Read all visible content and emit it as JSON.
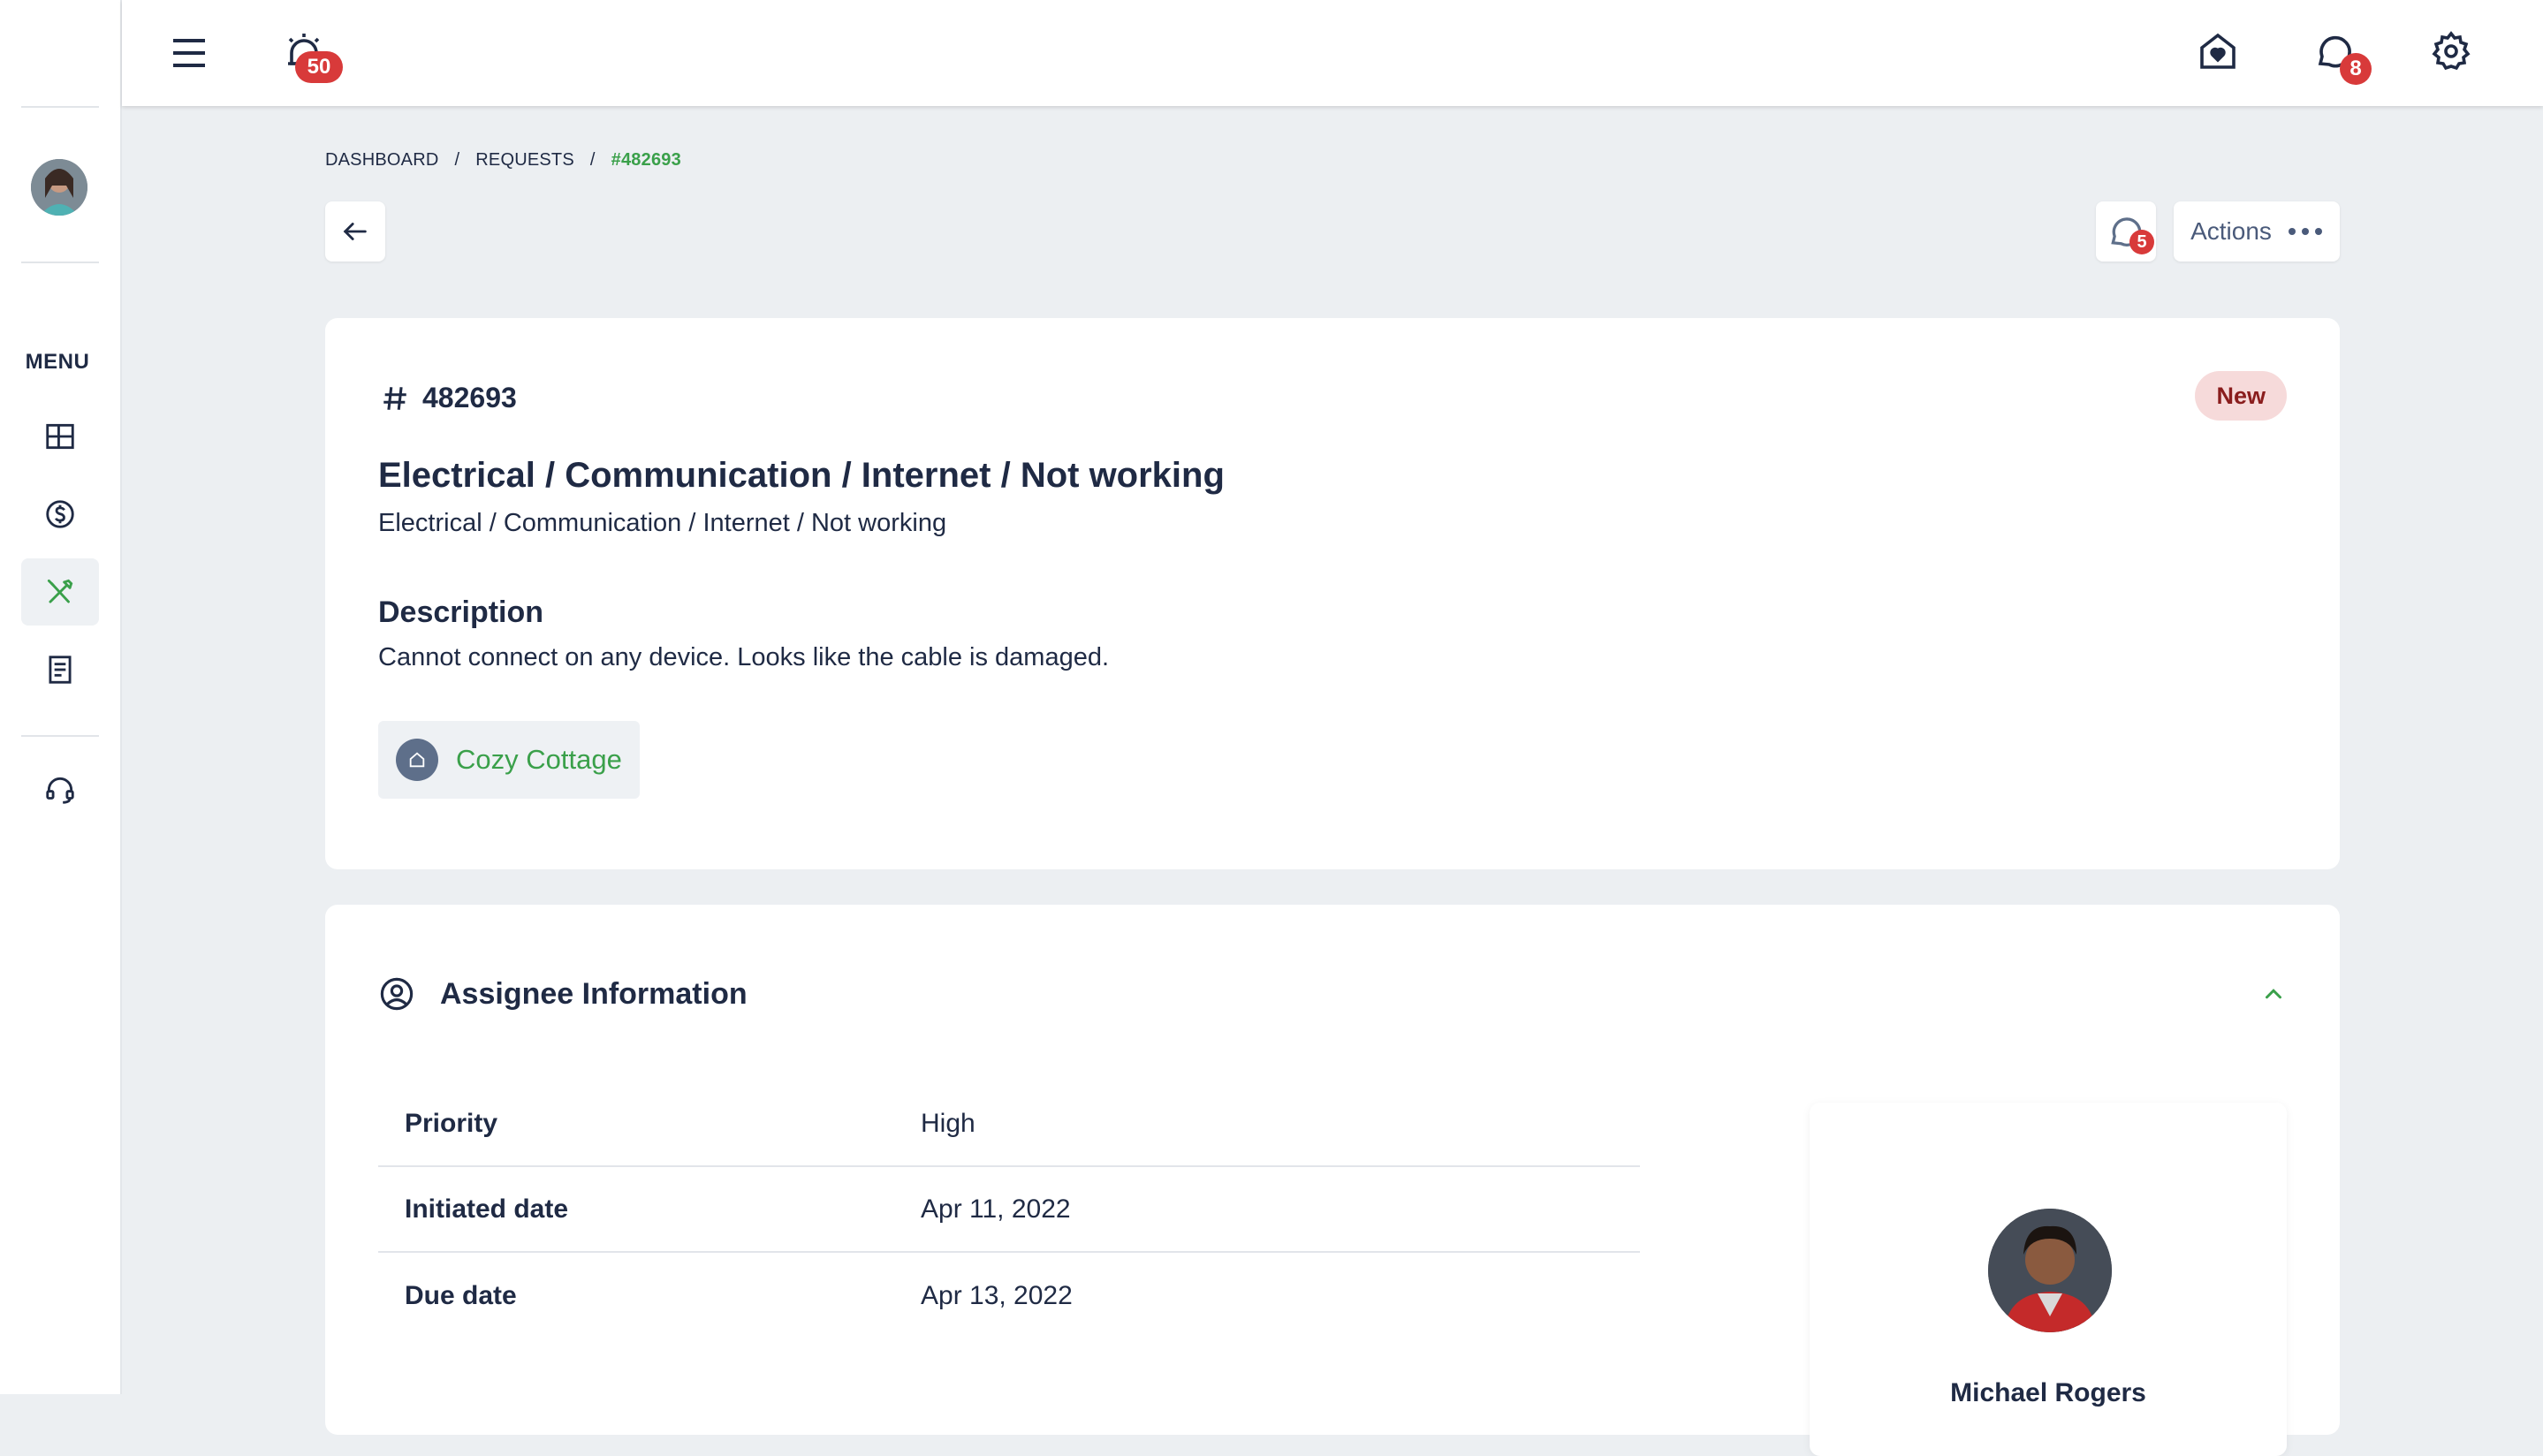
{
  "topbar": {
    "alarm_badge": "50",
    "chat_badge": "8",
    "menu_icon": "hamburger-icon",
    "alarm_icon": "alarm-icon",
    "home_icon": "home-heart-icon",
    "chat_icon": "chat-icon",
    "settings_icon": "gear-icon"
  },
  "sidebar": {
    "menu_label": "MENU",
    "items": [
      {
        "icon": "dashboard-icon",
        "active": false
      },
      {
        "icon": "dollar-circle-icon",
        "active": false
      },
      {
        "icon": "tools-icon",
        "active": true
      },
      {
        "icon": "document-icon",
        "active": false
      },
      {
        "icon": "headset-icon",
        "active": false
      }
    ]
  },
  "breadcrumb": {
    "items": [
      "DASHBOARD",
      "REQUESTS",
      "#482693"
    ],
    "separator": "/"
  },
  "toolbar": {
    "chat_badge": "5",
    "actions_label": "Actions"
  },
  "request": {
    "id": "482693",
    "status": "New",
    "title": "Electrical / Communication / Internet / Not working",
    "subtitle": "Electrical / Communication / Internet / Not working",
    "description_title": "Description",
    "description": "Cannot connect on any device. Looks like the cable is damaged.",
    "property": "Cozy Cottage"
  },
  "assignee_section": {
    "title": "Assignee Information",
    "rows": [
      {
        "label": "Priority",
        "value": "High"
      },
      {
        "label": "Initiated date",
        "value": "Apr 11, 2022"
      },
      {
        "label": "Due date",
        "value": "Apr 13, 2022"
      }
    ],
    "assignee_name": "Michael Rogers"
  },
  "colors": {
    "accent_green": "#3aa04a",
    "badge_red": "#d83a3a",
    "status_bg": "#f6dada",
    "status_text": "#8a1d1d",
    "text_dark": "#1f2a44"
  }
}
